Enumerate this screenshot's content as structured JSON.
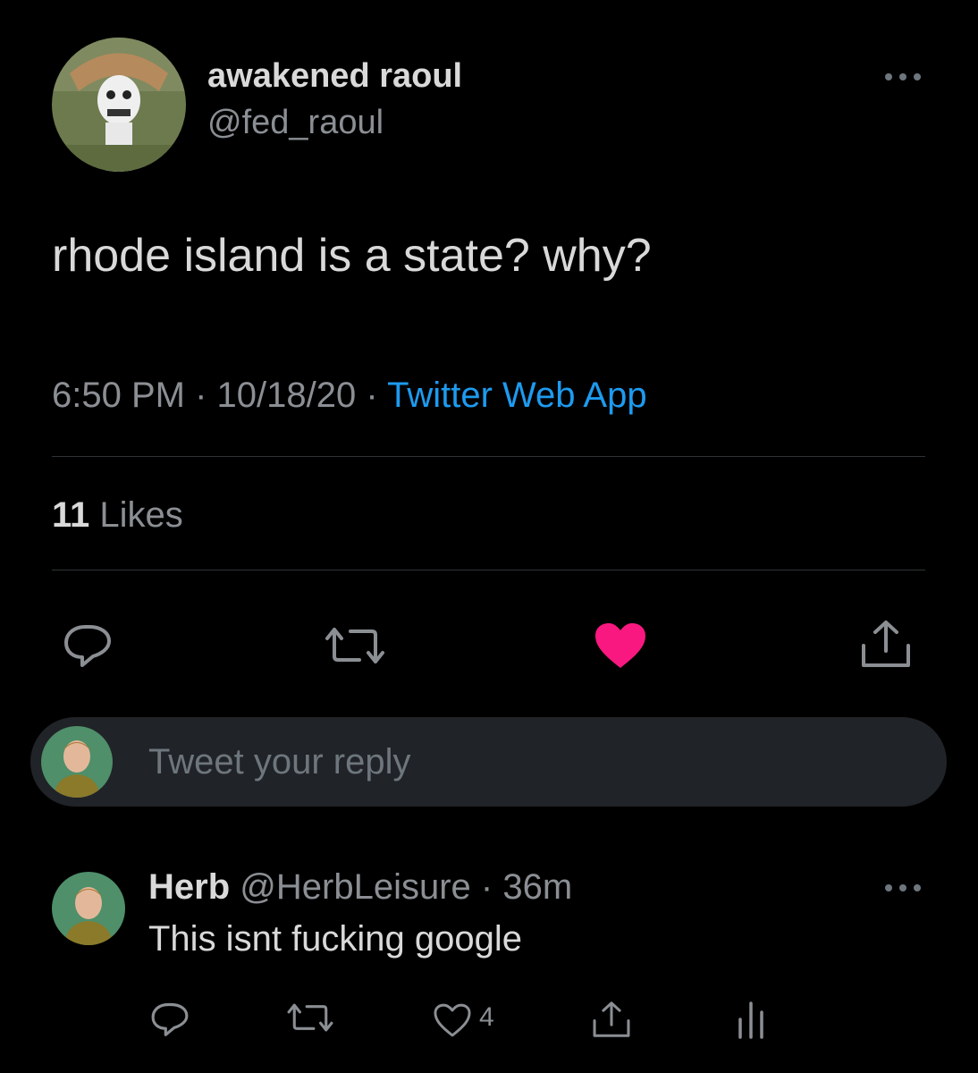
{
  "tweet": {
    "display_name": "awakened raoul",
    "handle": "@fed_raoul",
    "text": "rhode island is a state? why?",
    "time": "6:50 PM",
    "separator": "·",
    "date": "10/18/20",
    "source": "Twitter Web App",
    "likes_count": "11",
    "likes_label": "Likes",
    "liked": true,
    "more_icon": "more-horizontal-icon",
    "actions": [
      "reply-icon",
      "retweet-icon",
      "heart-filled-icon",
      "share-icon"
    ]
  },
  "reply_box": {
    "placeholder": "Tweet your reply"
  },
  "comment": {
    "name": "Herb",
    "handle": "@HerbLeisure",
    "separator": "·",
    "time": "36m",
    "text": "This isnt fucking google",
    "like_count": "4",
    "actions": [
      "reply-icon",
      "retweet-icon",
      "heart-outline-icon",
      "share-icon",
      "analytics-icon"
    ]
  },
  "colors": {
    "background": "#000000",
    "text": "#d9d9d9",
    "secondary": "#8b8f94",
    "link": "#1d9bf0",
    "like": "#f91880",
    "reply_box": "#202327"
  }
}
